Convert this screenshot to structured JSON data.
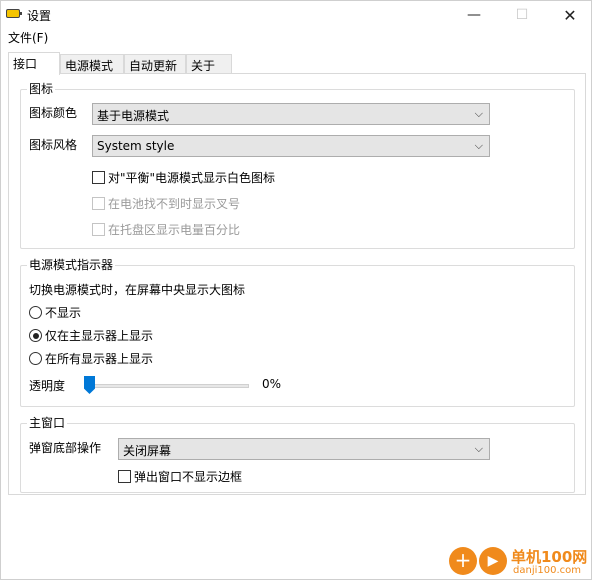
{
  "window": {
    "title": "设置",
    "controls": {
      "minimize": "—",
      "maximize": "☐",
      "close": "✕"
    }
  },
  "menubar": {
    "file": "文件(F)"
  },
  "tabs": [
    {
      "label": "接口",
      "active": true
    },
    {
      "label": "电源模式",
      "active": false
    },
    {
      "label": "自动更新",
      "active": false
    },
    {
      "label": "关于",
      "active": false
    }
  ],
  "icon_group": {
    "title": "图标",
    "color_label": "图标颜色",
    "color_value": "基于电源模式",
    "style_label": "图标风格",
    "style_value": "System style",
    "checkbox_white_icon": "对\"平衡\"电源模式显示白色图标",
    "checkbox_no_battery": "在电池找不到时显示叉号",
    "checkbox_battery_percent": "在托盘区显示电量百分比"
  },
  "indicator_group": {
    "title": "电源模式指示器",
    "description": "切换电源模式时，在屏幕中央显示大图标",
    "radio_none": "不显示",
    "radio_primary": "仅在主显示器上显示",
    "radio_all": "在所有显示器上显示",
    "selected": "radio_primary",
    "opacity_label": "透明度",
    "opacity_value": "0%",
    "opacity_fraction": 0.0
  },
  "main_window_group": {
    "title": "主窗口",
    "bottom_action_label": "弹窗底部操作",
    "bottom_action_value": "关闭屏幕",
    "checkbox_no_border": "弹出窗口不显示边框"
  },
  "combo_arrow": "⌵",
  "watermark": {
    "text": "单机100网",
    "url": "danji100.com",
    "glyph1": "+",
    "glyph2": "▶"
  },
  "colors": {
    "accent": "#0078d7",
    "watermark": "#f08a1c"
  }
}
